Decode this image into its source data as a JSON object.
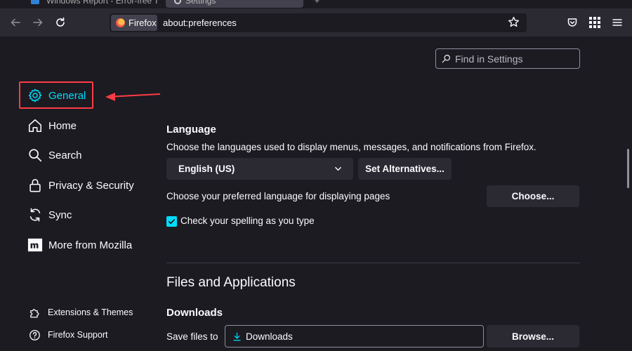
{
  "tabs": [
    {
      "title": "Windows Report - Error-free Tech Life",
      "active": false
    },
    {
      "title": "Settings",
      "active": true
    }
  ],
  "newtab": "+",
  "navbar": {
    "identity_label": "Firefox",
    "url": "about:preferences"
  },
  "sidebar": {
    "items": [
      {
        "label": "General",
        "icon": "gear-icon",
        "selected": true
      },
      {
        "label": "Home",
        "icon": "home-icon"
      },
      {
        "label": "Search",
        "icon": "search-icon"
      },
      {
        "label": "Privacy & Security",
        "icon": "lock-icon"
      },
      {
        "label": "Sync",
        "icon": "sync-icon"
      },
      {
        "label": "More from Mozilla",
        "icon": "mozilla-icon"
      }
    ],
    "footer": [
      {
        "label": "Extensions & Themes",
        "icon": "puzzle-icon"
      },
      {
        "label": "Firefox Support",
        "icon": "help-icon"
      }
    ]
  },
  "find": {
    "placeholder": "Find in Settings"
  },
  "language": {
    "heading": "Language",
    "description": "Choose the languages used to display menus, messages, and notifications from Firefox.",
    "selected_language": "English (US)",
    "set_alternatives_label": "Set Alternatives...",
    "pages_description": "Choose your preferred language for displaying pages",
    "choose_label": "Choose...",
    "spell_check_label": "Check your spelling as you type",
    "spell_check_checked": true
  },
  "files": {
    "heading": "Files and Applications",
    "downloads_heading": "Downloads",
    "save_files_label": "Save files to",
    "downloads_folder": "Downloads",
    "browse_label": "Browse..."
  },
  "colors": {
    "accent": "#00ddff",
    "highlight_box": "#ff3b45",
    "background": "#1c1b22",
    "toolbar": "#2b2a33"
  }
}
